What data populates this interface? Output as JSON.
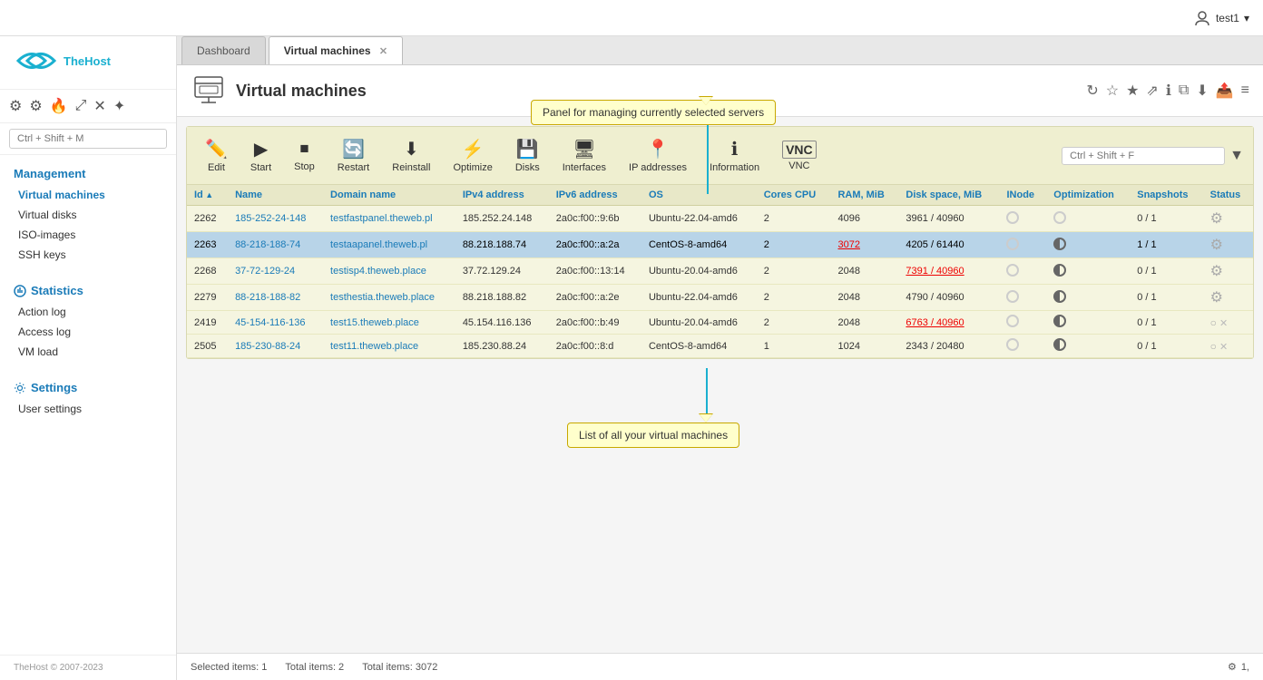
{
  "app": {
    "title": "TheHost",
    "copyright": "TheHost © 2007-2023"
  },
  "topbar": {
    "user": "test1",
    "chevron": "▾"
  },
  "tabs": [
    {
      "label": "Dashboard",
      "active": false,
      "closable": false
    },
    {
      "label": "Virtual machines",
      "active": true,
      "closable": true
    }
  ],
  "page": {
    "title": "Virtual machines"
  },
  "sidebar": {
    "search_placeholder": "Ctrl + Shift + M",
    "management_label": "Management",
    "items_management": [
      {
        "label": "Virtual machines",
        "active": true
      },
      {
        "label": "Virtual disks",
        "active": false
      },
      {
        "label": "ISO-images",
        "active": false
      },
      {
        "label": "SSH keys",
        "active": false
      }
    ],
    "statistics_label": "Statistics",
    "items_statistics": [
      {
        "label": "Action log",
        "active": false
      },
      {
        "label": "Access log",
        "active": false
      },
      {
        "label": "VM load",
        "active": false
      }
    ],
    "settings_label": "Settings",
    "items_settings": [
      {
        "label": "User settings",
        "active": false
      }
    ]
  },
  "toolbar": {
    "buttons": [
      {
        "label": "Edit",
        "icon": "✏️",
        "disabled": false
      },
      {
        "label": "Start",
        "icon": "▶",
        "disabled": false
      },
      {
        "label": "Stop",
        "icon": "⏹",
        "disabled": false
      },
      {
        "label": "Restart",
        "icon": "🔄",
        "disabled": false
      },
      {
        "label": "Reinstall",
        "icon": "⬇",
        "disabled": false
      },
      {
        "label": "Optimize",
        "icon": "⚡",
        "disabled": false
      },
      {
        "label": "Disks",
        "icon": "💾",
        "disabled": false
      },
      {
        "label": "Interfaces",
        "icon": "🖥",
        "disabled": false
      },
      {
        "label": "IP addresses",
        "icon": "📍",
        "disabled": false
      },
      {
        "label": "Information",
        "icon": "ℹ",
        "disabled": false
      },
      {
        "label": "VNC",
        "icon": "VNC",
        "disabled": false
      }
    ],
    "search_placeholder": "Ctrl + Shift + F"
  },
  "table": {
    "columns": [
      "Id",
      "Name",
      "Domain name",
      "IPv4 address",
      "IPv6 address",
      "OS",
      "Cores CPU",
      "RAM, MiB",
      "Disk space, MiB",
      "INode",
      "Optimization",
      "Snapshots",
      "Status"
    ],
    "rows": [
      {
        "id": "2262",
        "name": "185-252-24-148",
        "domain": "testfastpanel.theweb.pl",
        "ipv4": "185.252.24.148",
        "ipv6": "2a0c:f00::9:6b",
        "os": "Ubuntu-22.04-amd6",
        "cores": "2",
        "ram": "4096",
        "disk": "3961 / 40960",
        "inode_empty": true,
        "optim_half": false,
        "snapshots": "0 / 1",
        "status_gear": true,
        "disk_red": false,
        "ram_red": false,
        "selected": false
      },
      {
        "id": "2263",
        "name": "88-218-188-74",
        "domain": "testaapanel.theweb.pl",
        "ipv4": "88.218.188.74",
        "ipv6": "2a0c:f00::a:2a",
        "os": "CentOS-8-amd64",
        "cores": "2",
        "ram": "3072",
        "disk": "4205 / 61440",
        "inode_empty": true,
        "optim_half": true,
        "snapshots": "1 / 1",
        "status_gear": true,
        "disk_red": false,
        "ram_red": true,
        "selected": true
      },
      {
        "id": "2268",
        "name": "37-72-129-24",
        "domain": "testisp4.theweb.place",
        "ipv4": "37.72.129.24",
        "ipv6": "2a0c:f00::13:14",
        "os": "Ubuntu-20.04-amd6",
        "cores": "2",
        "ram": "2048",
        "disk": "7391 / 40960",
        "inode_empty": true,
        "optim_half": true,
        "snapshots": "0 / 1",
        "status_gear": true,
        "disk_red": true,
        "ram_red": false,
        "selected": false
      },
      {
        "id": "2279",
        "name": "88-218-188-82",
        "domain": "testhestia.theweb.place",
        "ipv4": "88.218.188.82",
        "ipv6": "2a0c:f00::a:2e",
        "os": "Ubuntu-22.04-amd6",
        "cores": "2",
        "ram": "2048",
        "disk": "4790 / 40960",
        "inode_empty": true,
        "optim_half": true,
        "snapshots": "0 / 1",
        "status_gear": true,
        "disk_red": false,
        "ram_red": false,
        "selected": false
      },
      {
        "id": "2419",
        "name": "45-154-116-136",
        "domain": "test15.theweb.place",
        "ipv4": "45.154.116.136",
        "ipv6": "2a0c:f00::b:49",
        "os": "Ubuntu-20.04-amd6",
        "cores": "2",
        "ram": "2048",
        "disk": "6763 / 40960",
        "inode_empty": true,
        "optim_half": true,
        "snapshots": "0 / 1",
        "status_circle": true,
        "status_gear": false,
        "disk_red": true,
        "ram_red": false,
        "selected": false
      },
      {
        "id": "2505",
        "name": "185-230-88-24",
        "domain": "test11.theweb.place",
        "ipv4": "185.230.88.24",
        "ipv6": "2a0c:f00::8:d",
        "os": "CentOS-8-amd64",
        "cores": "1",
        "ram": "1024",
        "disk": "2343 / 20480",
        "inode_empty": true,
        "optim_half": true,
        "snapshots": "0 / 1",
        "status_circle": true,
        "status_gear": false,
        "disk_red": false,
        "ram_red": false,
        "selected": false
      }
    ]
  },
  "tooltips": {
    "top": "Panel for managing currently selected servers",
    "bottom": "List of all your virtual machines"
  },
  "statusbar": {
    "selected": "Selected items: 1",
    "total_items": "Total items: 2",
    "total_ram": "Total items: 3072",
    "gear_icon": "⚙",
    "count": "1,"
  }
}
